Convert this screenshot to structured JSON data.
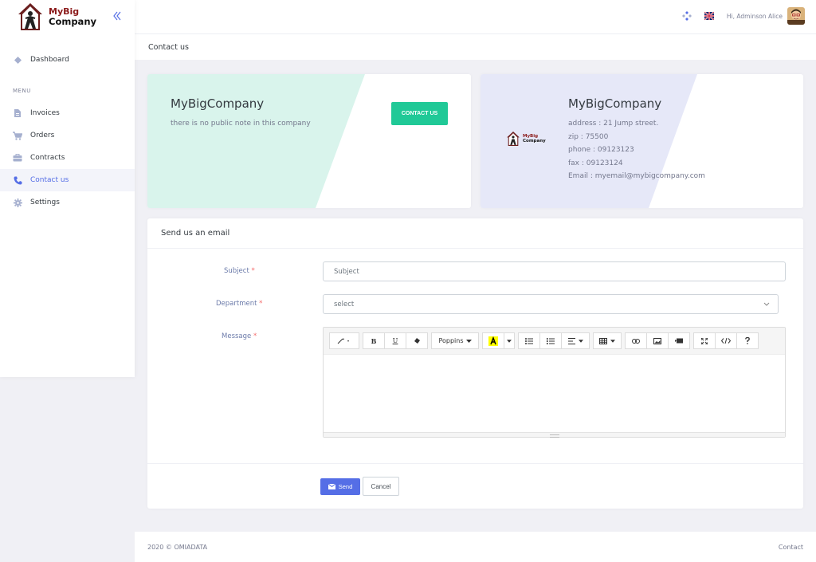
{
  "brand": {
    "line1": "MyBig",
    "line2": "Company"
  },
  "sidebar": {
    "menu_title": "MENU",
    "items": [
      {
        "label": "Dashboard",
        "icon": "diamond-icon"
      },
      {
        "label": "Invoices",
        "icon": "document-icon"
      },
      {
        "label": "Orders",
        "icon": "cart-icon"
      },
      {
        "label": "Contracts",
        "icon": "briefcase-icon"
      },
      {
        "label": "Contact us",
        "icon": "phone-icon"
      },
      {
        "label": "Settings",
        "icon": "gear-icon"
      }
    ],
    "active_index": 4
  },
  "topbar": {
    "greeting": "Hi, Adminson Alice"
  },
  "page": {
    "title": "Contact us"
  },
  "company_card": {
    "name": "MyBigCompany",
    "note": "there is no public note in this company",
    "button_label": "CONTACT US",
    "accent_color": "#d9f4ec"
  },
  "info_card": {
    "name": "MyBigCompany",
    "address": "address : 21 Jump street.",
    "zip": "zip : 75500",
    "phone": "phone : 09123123",
    "fax": "fax : 09123124",
    "email": "Email : myemail@mybigcompany.com",
    "accent_color": "#e6e8f8"
  },
  "form": {
    "title": "Send us an email",
    "subject_label": "Subject",
    "subject_placeholder": "Subject",
    "department_label": "Department",
    "department_value": "select",
    "message_label": "Message",
    "required_mark": "*",
    "font_name": "Poppins",
    "send_label": "Send",
    "cancel_label": "Cancel"
  },
  "footer": {
    "copyright": "2020 © OMIADATA",
    "contact": "Contact"
  },
  "colors": {
    "primary": "#556ee6",
    "success": "#20c997",
    "danger": "#f46a6a"
  }
}
